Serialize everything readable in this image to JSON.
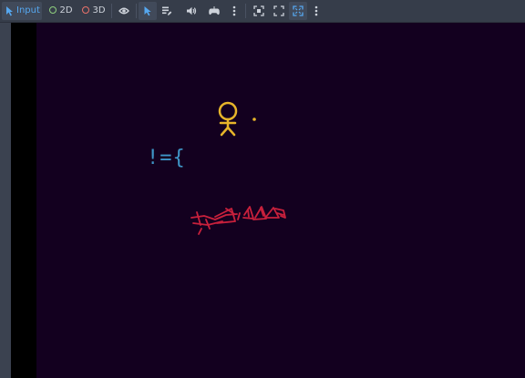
{
  "toolbar": {
    "input_label": "Input",
    "mode_2d_label": "2D",
    "mode_3d_label": "3D",
    "icons": [
      "input-icon",
      "eye-icon",
      "select-cursor-icon",
      "list-edit-icon",
      "speaker-icon",
      "controller-icon",
      "more-vertical-icon",
      "camera-focus-icon",
      "zoom-fit-icon",
      "fullscreen-icon",
      "more-vertical-icon"
    ]
  },
  "viewport": {
    "background": "#13001f",
    "glyph_text": "!={"
  },
  "colors": {
    "accent": "#56a8f0",
    "mode_2d": "#8fcf7e",
    "mode_3d": "#e9726a",
    "figure_yellow": "#e7b52a",
    "text_blue": "#3f97c9",
    "scribble_red": "#c8203c"
  }
}
